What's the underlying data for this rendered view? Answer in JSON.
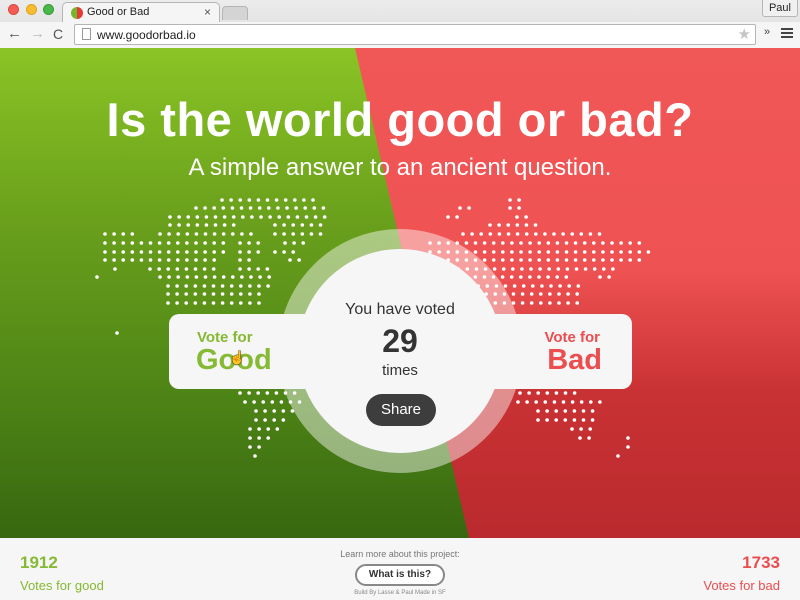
{
  "browser": {
    "tab_title": "Good or Bad",
    "tab_close": "×",
    "profile_name": "Paul",
    "url": "www.goodorbad.io",
    "back_icon": "←",
    "forward_icon": "→",
    "reload_icon": "C",
    "star_icon": "★",
    "extensions_icon": "»"
  },
  "hero": {
    "title": "Is the world good or bad?",
    "subtitle": "A simple answer to an ancient question."
  },
  "vote_good": {
    "label_small": "Vote for",
    "label_large": "Good",
    "color": "#86b934"
  },
  "vote_bad": {
    "label_small": "Vote for",
    "label_large": "Bad",
    "color": "#ec4d4f"
  },
  "voted": {
    "label": "You have voted",
    "count": "29",
    "unit": "times",
    "share_label": "Share"
  },
  "footer": {
    "good_count": "1912",
    "good_label": "Votes for good",
    "bad_count": "1733",
    "bad_label": "Votes for bad",
    "learn_more": "Learn more about this project:",
    "what_button": "What is this?",
    "credits": "Build By Lasse & Paul Made in SF"
  },
  "colors": {
    "good": "#86b934",
    "bad": "#ec4d4f",
    "good_bg_top": "#8ac425",
    "bad_bg_top": "#f05757"
  }
}
